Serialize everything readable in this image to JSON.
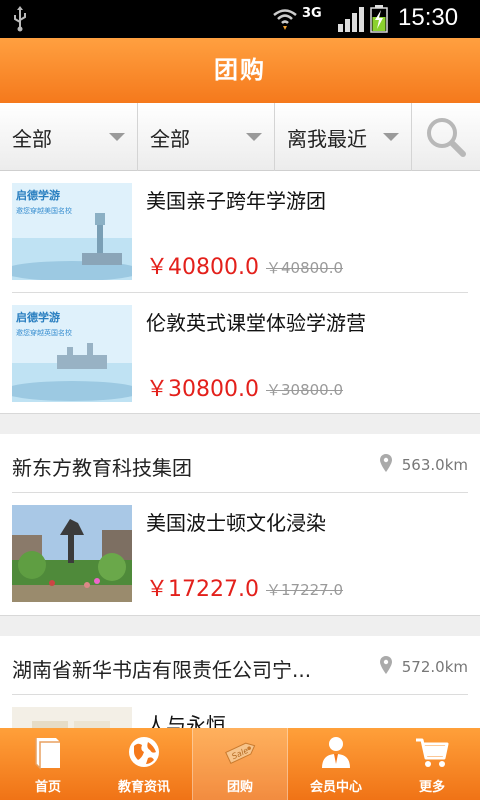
{
  "status_bar": {
    "network": "3G",
    "time": "15:30"
  },
  "title_bar": {
    "title": "团购"
  },
  "filters": [
    {
      "label": "全部"
    },
    {
      "label": "全部"
    },
    {
      "label": "离我最近"
    }
  ],
  "deals": {
    "group1": {
      "items": [
        {
          "name": "美国亲子跨年学游团",
          "price": "￥40800.0",
          "original_price": "￥40800.0",
          "thumb_brand": "启德学游",
          "thumb_slogan": "邀您穿越美国名校"
        },
        {
          "name": "伦敦英式课堂体验学游营",
          "price": "￥30800.0",
          "original_price": "￥30800.0",
          "thumb_brand": "启德学游",
          "thumb_slogan": "邀您穿越英国名校"
        }
      ]
    },
    "group2": {
      "store": "新东方教育科技集团",
      "distance": "563.0km",
      "items": [
        {
          "name": "美国波士顿文化浸染",
          "price": "￥17227.0",
          "original_price": "￥17227.0"
        }
      ]
    },
    "group3": {
      "store": "湖南省新华书店有限责任公司宁...",
      "distance": "572.0km",
      "items": [
        {
          "name": "人与永恒"
        }
      ]
    }
  },
  "tab_bar": {
    "tabs": [
      {
        "label": "首页",
        "icon": "book-icon"
      },
      {
        "label": "教育资讯",
        "icon": "globe-icon"
      },
      {
        "label": "团购",
        "icon": "sale-tag-icon",
        "active": true
      },
      {
        "label": "会员中心",
        "icon": "member-icon"
      },
      {
        "label": "更多",
        "icon": "cart-icon"
      }
    ]
  },
  "colors": {
    "accent": "#f5791c",
    "price": "#e3201b"
  }
}
